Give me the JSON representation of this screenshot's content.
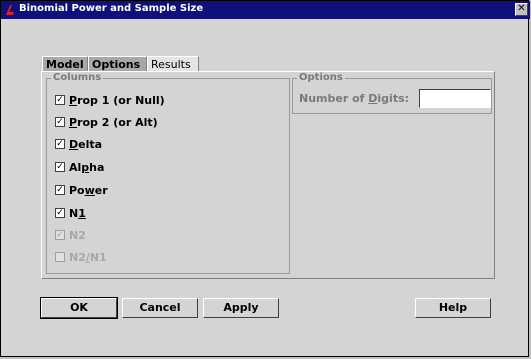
{
  "window": {
    "title": "Binomial Power and Sample Size",
    "close_glyph": "✕"
  },
  "tabs": [
    {
      "label": "Model",
      "active": false
    },
    {
      "label": "Options",
      "active": false
    },
    {
      "label": "Results",
      "active": true
    }
  ],
  "columns_group": {
    "legend": "Columns",
    "items": [
      {
        "pre": "",
        "u": "P",
        "post": "rop 1 (or Null)",
        "checked": true,
        "enabled": true
      },
      {
        "pre": "",
        "u": "P",
        "post": "rop 2 (or Alt)",
        "checked": true,
        "enabled": true
      },
      {
        "pre": "",
        "u": "D",
        "post": "elta",
        "checked": true,
        "enabled": true
      },
      {
        "pre": "Al",
        "u": "p",
        "post": "ha",
        "checked": true,
        "enabled": true
      },
      {
        "pre": "Po",
        "u": "w",
        "post": "er",
        "checked": true,
        "enabled": true
      },
      {
        "pre": "N",
        "u": "1",
        "post": "",
        "checked": true,
        "enabled": true
      },
      {
        "pre": "N2",
        "u": "",
        "post": "",
        "checked": true,
        "enabled": false
      },
      {
        "pre": "N2",
        "u": "/",
        "post": "N1",
        "checked": false,
        "enabled": false
      }
    ]
  },
  "options_group": {
    "legend": "Options",
    "digits_label_pre": "Number of ",
    "digits_label_u": "D",
    "digits_label_post": "igits:",
    "digits_value": ""
  },
  "buttons": {
    "ok": "OK",
    "cancel": "Cancel",
    "apply": "Apply",
    "help": "Help"
  }
}
